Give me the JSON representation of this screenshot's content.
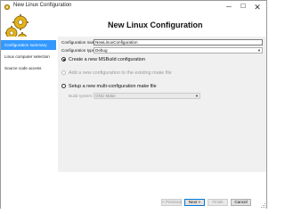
{
  "window": {
    "title": "New Linux Configuration",
    "minimize_glyph": "─",
    "maximize_glyph": "☐",
    "close_glyph": "✕"
  },
  "header": {
    "title": "New Linux Configuration"
  },
  "sidebar": {
    "items": [
      {
        "label": "Configuration summary",
        "active": true
      },
      {
        "label": "Linux computer selection",
        "active": false
      },
      {
        "label": "Source code access",
        "active": false
      }
    ]
  },
  "form": {
    "name_label": "Configuration name:",
    "name_value": "NewLinuxConfiguration",
    "type_label": "Configuration type:",
    "type_value": "Debug",
    "options": [
      {
        "label": "Create a new MSBuild configuration",
        "checked": true,
        "enabled": true
      },
      {
        "label": "Add a new configuration to the existing make file",
        "checked": false,
        "enabled": false
      },
      {
        "label": "Setup a new multi-configuration make file",
        "checked": false,
        "enabled": true
      }
    ],
    "build_system_label": "Build system:",
    "build_system_value": "GNU Make"
  },
  "footer": {
    "previous_label": "< Previous",
    "next_label": "Next >",
    "finish_label": "Finish",
    "cancel_label": "Cancel"
  },
  "colors": {
    "accent": "#3399ff",
    "content_bg": "#f0f0f0",
    "title": "#111111"
  },
  "icons": [
    "app-gear-icon",
    "logo-gears-icon",
    "resize-grip-icon",
    "chevron-down-icon"
  ]
}
